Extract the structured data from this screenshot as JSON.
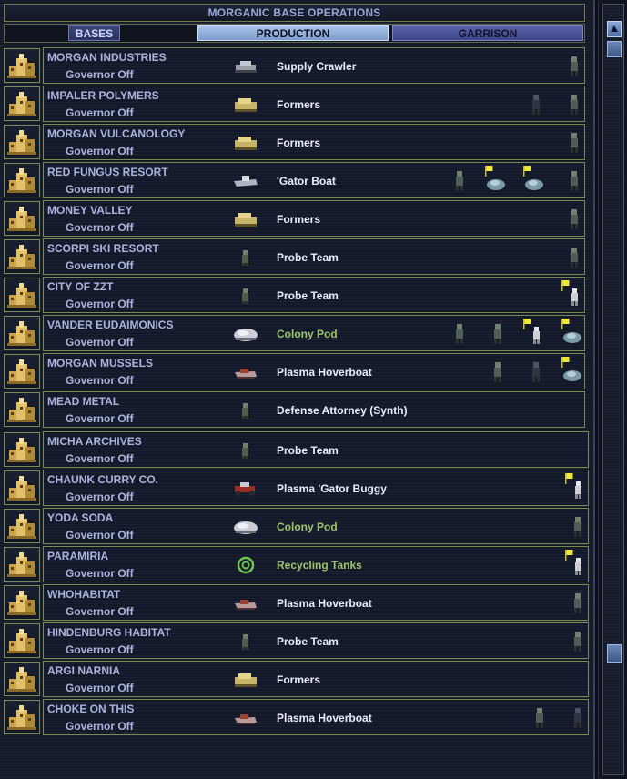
{
  "window": {
    "title": "MORGANIC BASE OPERATIONS"
  },
  "tabs": {
    "bases": "BASES",
    "production": "PRODUCTION",
    "garrison": "GARRISON",
    "active": "production"
  },
  "colors": {
    "normal_item": "#e8ecff",
    "secret_project": "#9cc46a",
    "label": "#aab4dc"
  },
  "bases": [
    {
      "name": "MORGAN INDUSTRIES",
      "governor": "Governor Off",
      "production": "Supply Crawler",
      "prod_icon": "crawler-icon",
      "secret": false,
      "garrison": [
        "infantry"
      ]
    },
    {
      "name": "IMPALER POLYMERS",
      "governor": "Governor Off",
      "production": "Formers",
      "prod_icon": "former-icon",
      "secret": false,
      "garrison": [
        "infantry-dark",
        "infantry"
      ]
    },
    {
      "name": "MORGAN VULCANOLOGY",
      "governor": "Governor Off",
      "production": "Formers",
      "prod_icon": "former-icon",
      "secret": false,
      "garrison": [
        "infantry"
      ]
    },
    {
      "name": "RED FUNGUS RESORT",
      "governor": "Governor Off",
      "production": "'Gator Boat",
      "prod_icon": "boat-icon",
      "secret": false,
      "garrison": [
        "infantry",
        "flag-rover",
        "flag-rover",
        "infantry"
      ]
    },
    {
      "name": "MONEY VALLEY",
      "governor": "Governor Off",
      "production": "Formers",
      "prod_icon": "former-icon",
      "secret": false,
      "garrison": [
        "infantry"
      ]
    },
    {
      "name": "SCORPI SKI RESORT",
      "governor": "Governor Off",
      "production": "Probe Team",
      "prod_icon": "probe-icon",
      "secret": false,
      "garrison": [
        "infantry"
      ]
    },
    {
      "name": "CITY OF ZZT",
      "governor": "Governor Off",
      "production": "Probe Team",
      "prod_icon": "probe-icon",
      "secret": false,
      "garrison": [
        "flag-trooper"
      ]
    },
    {
      "name": "VANDER EUDAIMONICS",
      "governor": "Governor Off",
      "production": "Colony Pod",
      "prod_icon": "colony-pod-icon",
      "secret": true,
      "garrison": [
        "infantry",
        "infantry",
        "flag-trooper",
        "flag-rover"
      ]
    },
    {
      "name": "MORGAN MUSSELS",
      "governor": "Governor Off",
      "production": "Plasma Hoverboat",
      "prod_icon": "hoverboat-icon",
      "secret": false,
      "garrison": [
        "infantry",
        "infantry-dark",
        "flag-rover"
      ]
    },
    {
      "name": "MEAD METAL",
      "governor": "Governor Off",
      "production": "Defense Attorney (Synth)",
      "prod_icon": "probe-icon",
      "secret": false,
      "garrison": []
    },
    {
      "name": "MICHA ARCHIVES",
      "governor": "Governor Off",
      "production": "Probe Team",
      "prod_icon": "probe-icon",
      "secret": false,
      "garrison": []
    },
    {
      "name": "CHAUNK CURRY CO.",
      "governor": "Governor Off",
      "production": "Plasma 'Gator Buggy",
      "prod_icon": "buggy-icon",
      "secret": false,
      "garrison": [
        "flag-trooper"
      ]
    },
    {
      "name": "YODA SODA",
      "governor": "Governor Off",
      "production": "Colony Pod",
      "prod_icon": "colony-pod-icon",
      "secret": true,
      "garrison": [
        "infantry"
      ]
    },
    {
      "name": "PARAMIRIA",
      "governor": "Governor Off",
      "production": "Recycling Tanks",
      "prod_icon": "recycling-icon",
      "secret": true,
      "garrison": [
        "flag-trooper"
      ]
    },
    {
      "name": "WHOHABITAT",
      "governor": "Governor Off",
      "production": "Plasma Hoverboat",
      "prod_icon": "hoverboat-icon",
      "secret": false,
      "garrison": [
        "infantry"
      ]
    },
    {
      "name": "HINDENBURG HABITAT",
      "governor": "Governor Off",
      "production": "Probe Team",
      "prod_icon": "probe-icon",
      "secret": false,
      "garrison": [
        "infantry"
      ]
    },
    {
      "name": "ARGI NARNIA",
      "governor": "Governor Off",
      "production": "Formers",
      "prod_icon": "former-icon",
      "secret": false,
      "garrison": []
    },
    {
      "name": "CHOKE ON THIS",
      "governor": "Governor Off",
      "production": "Plasma Hoverboat",
      "prod_icon": "hoverboat-icon",
      "secret": false,
      "garrison": [
        "infantry",
        "infantry-dark"
      ]
    }
  ]
}
